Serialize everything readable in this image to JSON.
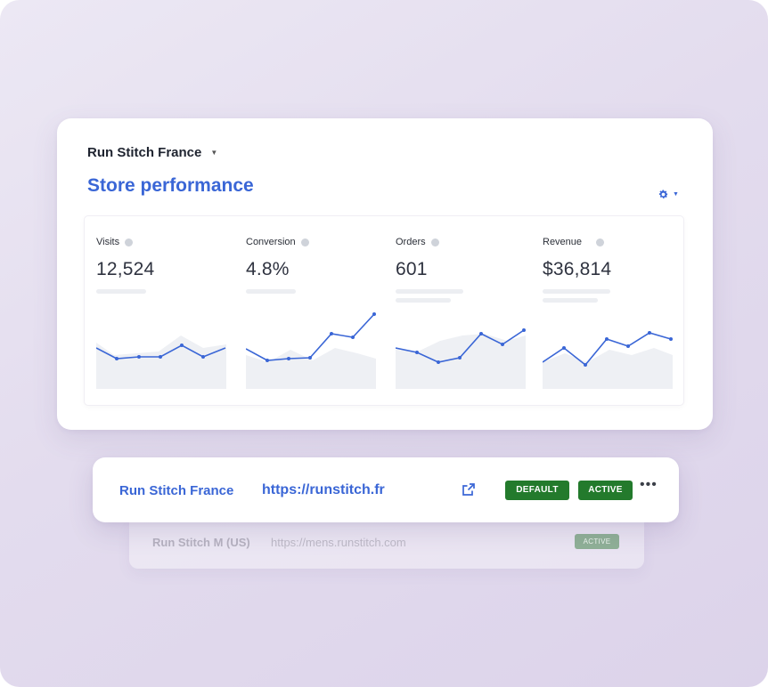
{
  "panel": {
    "store_name": "Run Stitch France",
    "title": "Store performance",
    "icons": {
      "caret": "chevron-down-icon",
      "settings": "gear-icon",
      "info": "info-icon"
    }
  },
  "metrics": [
    {
      "label": "Visits",
      "value": "12,524"
    },
    {
      "label": "Conversion",
      "value": "4.8%"
    },
    {
      "label": "Orders",
      "value": "601"
    },
    {
      "label": "Revenue",
      "value": "$36,814"
    }
  ],
  "stores": [
    {
      "name": "Run Stitch France",
      "url": "https://runstitch.fr",
      "badges": [
        "DEFAULT",
        "ACTIVE"
      ],
      "icons": [
        "external-link-icon",
        "more-icon"
      ]
    },
    {
      "name": "Run Stitch M (US)",
      "url": "https://mens.runstitch.com",
      "badges": [
        "ACTIVE"
      ]
    }
  ],
  "colors": {
    "accent": "#3a66d6",
    "badge_green": "#237a2c",
    "muted_badge": "#8fb096"
  }
}
